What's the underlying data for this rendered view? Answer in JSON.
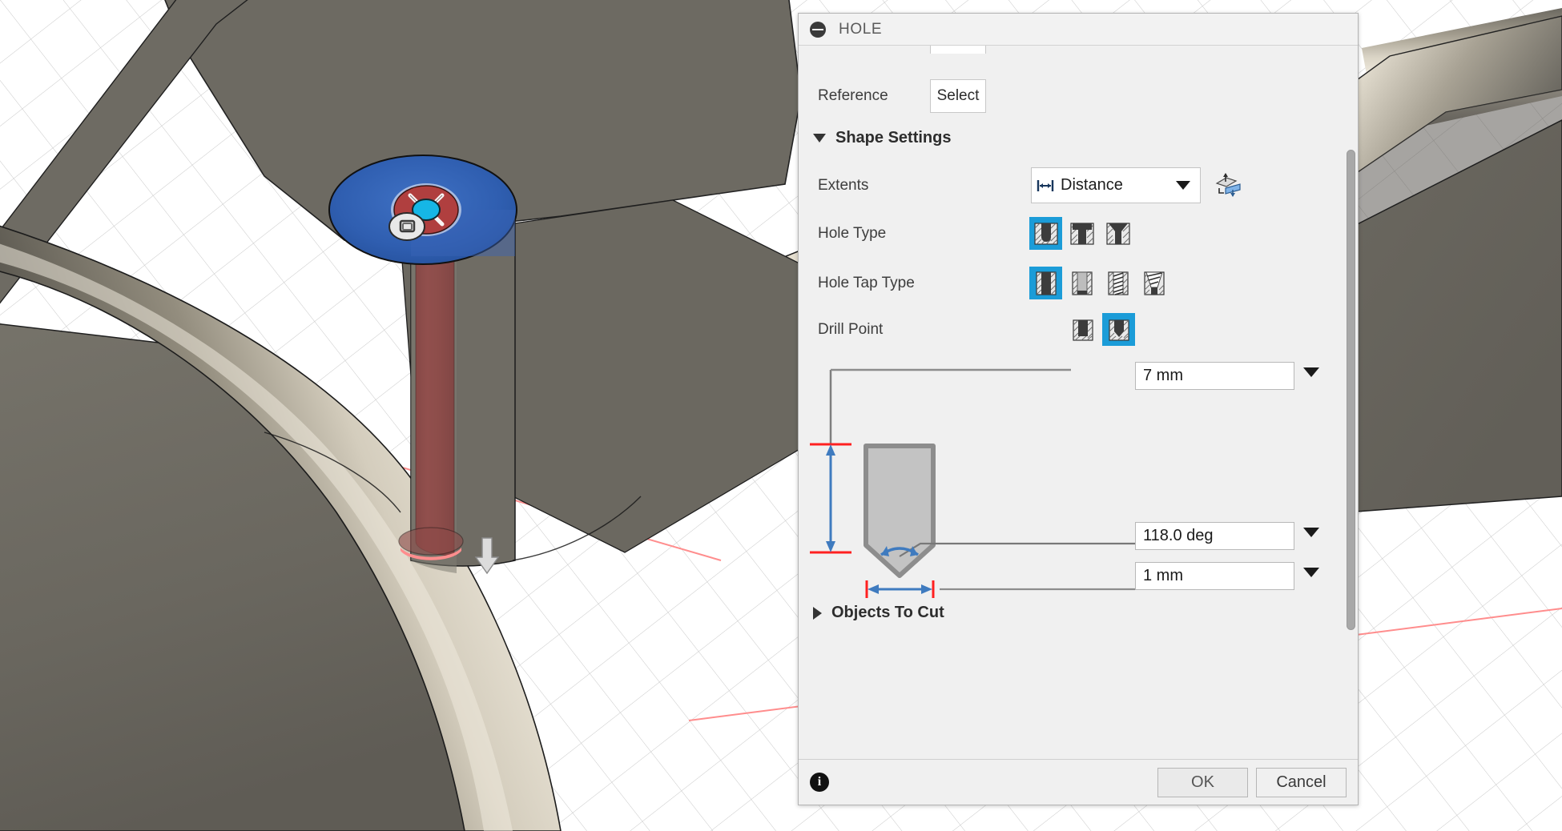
{
  "app": {
    "viewport_name": "3d-cad-viewport"
  },
  "panel": {
    "title": "HOLE",
    "collapse_icon": "minus-circle-icon",
    "reference": {
      "label": "Reference",
      "select_button": "Select"
    },
    "shape_settings": {
      "title": "Shape Settings",
      "expanded": true,
      "extents": {
        "label": "Extents",
        "value": "Distance",
        "icon": "distance-icon",
        "flip_icon": "flip-direction-icon"
      },
      "hole_type": {
        "label": "Hole Type",
        "options": [
          "simple-hole-icon",
          "counterbore-hole-icon",
          "countersink-hole-icon"
        ],
        "selected_index": 0
      },
      "hole_tap_type": {
        "label": "Hole Tap Type",
        "options": [
          "simple-tap-icon",
          "clearance-tap-icon",
          "tapped-tap-icon",
          "taper-tapped-tap-icon"
        ],
        "selected_index": 0
      },
      "drill_point": {
        "label": "Drill Point",
        "options": [
          "flat-drill-point-icon",
          "angle-drill-point-icon"
        ],
        "selected_index": 1
      },
      "fields": [
        {
          "name": "hole-depth",
          "value": "7 mm"
        },
        {
          "name": "drill-point-angle",
          "value": "118.0 deg"
        },
        {
          "name": "hole-diameter",
          "value": "1 mm"
        }
      ]
    },
    "objects_to_cut": {
      "title": "Objects To Cut",
      "expanded": false
    },
    "footer": {
      "info_icon": "info-icon",
      "ok_label": "OK",
      "cancel_label": "Cancel"
    }
  },
  "colors": {
    "accent_selected": "#1b9cd8",
    "panel_bg": "#f0f0f0",
    "face_highlight": "#2a5fb4",
    "hole_preview": "#8f4a48",
    "dimension_blue": "#3f7bbf",
    "dimension_red": "#ff2a2a",
    "model_gray": "#6d6a62"
  }
}
